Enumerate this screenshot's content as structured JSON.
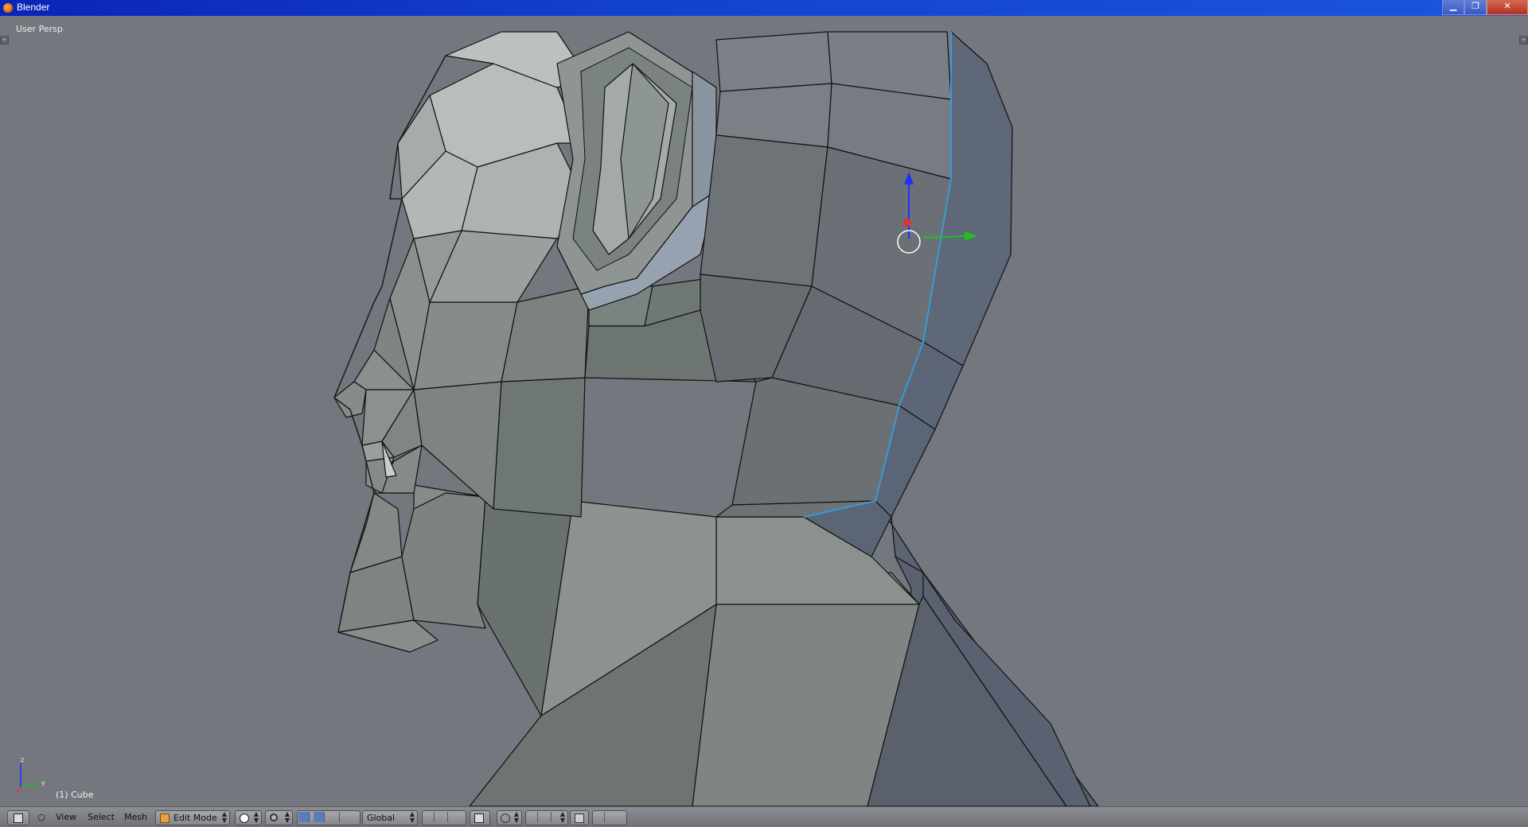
{
  "window": {
    "title": "Blender",
    "buttons": {
      "minimize": "▁",
      "maximize": "❐",
      "close": "✕"
    }
  },
  "viewport": {
    "view_name": "User Persp",
    "object_name": "(1) Cube",
    "background_color": "#75777e",
    "axes": {
      "x_color": "#e03030",
      "y_color": "#20c020",
      "z_color": "#2030ff"
    }
  },
  "header": {
    "menus": [
      "View",
      "Select",
      "Mesh"
    ],
    "mode": "Edit Mode",
    "orientation": "Global",
    "icons": {
      "editor_type": "3d-view-icon",
      "mode": "edit-mode-icon",
      "shading": "solid-shading-icon",
      "pivot": "pivot-point-icon",
      "manipulator": "manipulator-icon",
      "select_mode": "vertex-edge-face-select-icon",
      "occlude": "occlude-geometry-icon",
      "proportional": "proportional-edit-icon",
      "snap": "snap-icon",
      "render": "render-icon"
    }
  }
}
